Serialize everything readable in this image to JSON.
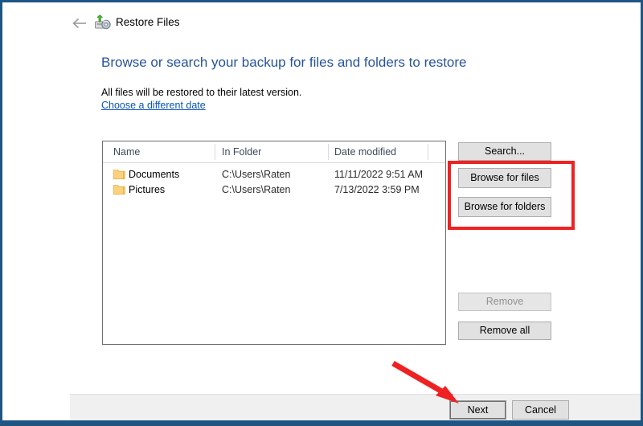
{
  "window": {
    "title": "Restore Files",
    "back_icon": "back-arrow-icon",
    "title_icon": "restore-files-icon",
    "accent_color": "#1F5582"
  },
  "content": {
    "heading": "Browse or search your backup for files and folders to restore",
    "subtitle": "All files will be restored to their latest version.",
    "date_link": "Choose a different date",
    "heading_color": "#27539B",
    "link_color": "#0B55B5"
  },
  "file_list": {
    "columns": [
      "Name",
      "In Folder",
      "Date modified"
    ],
    "rows": [
      {
        "icon": "folder-icon",
        "name": "Documents",
        "in_folder": "C:\\Users\\Raten",
        "date_modified": "11/11/2022 9:51 AM"
      },
      {
        "icon": "folder-icon",
        "name": "Pictures",
        "in_folder": "C:\\Users\\Raten",
        "date_modified": "7/13/2022 3:59 PM"
      }
    ]
  },
  "side_buttons": {
    "search": "Search...",
    "browse_files": "Browse for files",
    "browse_folders": "Browse for folders",
    "remove": "Remove",
    "remove_all": "Remove all"
  },
  "footer": {
    "next": "Next",
    "cancel": "Cancel"
  },
  "annotations": {
    "highlight_color": "#EE2222",
    "box_target": "browse-buttons-group",
    "arrow_target": "next-button"
  }
}
